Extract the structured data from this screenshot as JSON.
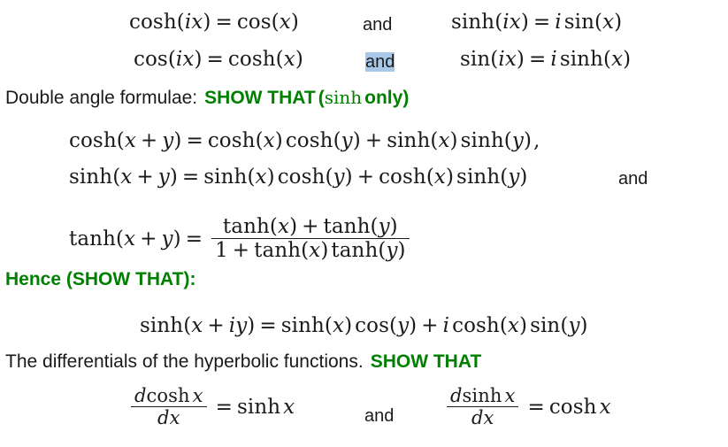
{
  "page": {
    "background_color": "#ffffff",
    "text_color": "#1a1a1a",
    "accent_color": "#008000",
    "highlight_color": "#a8c8e8"
  },
  "identities_rows": [
    {
      "left": "cosh(ix) = cos(x)",
      "connector": "and",
      "right": "sinh(ix) = i sin(x)"
    },
    {
      "left": "cos(ix) = cosh(x)",
      "connector": "and",
      "right": "sin(ix) = i sinh(x)"
    }
  ],
  "double_angle_heading": {
    "prefix": "Double angle formulae:",
    "show_that": "SHOW THAT",
    "paren_open": "(",
    "func": "sinh",
    "only": "only",
    "paren_close": ")"
  },
  "addition_formulae": [
    {
      "text": "cosh(x + y) = cosh(x) cosh(y) + sinh(x) sinh(y) ,",
      "trailing_comma": ","
    },
    {
      "text": "sinh(x + y) = sinh(x) cosh(y) + cosh(x) sinh(y)",
      "connector": "and"
    },
    {
      "lhs": "tanh(x + y) =",
      "numerator": "tanh(x) + tanh(y)",
      "denominator": "1 + tanh(x) tanh(y)"
    }
  ],
  "hence_heading": "Hence (SHOW THAT):",
  "complex_sinh": "sinh(x + iy) = sinh(x) cos(y) + i cosh(x) sin(y)",
  "differentials_heading": {
    "prefix": "The differentials of the hyperbolic functions.",
    "show_that": "SHOW THAT"
  },
  "derivatives": [
    {
      "numerator": "dcosh x",
      "denominator": "dx",
      "equals": "=",
      "result": "sinh x"
    },
    {
      "connector": "and"
    },
    {
      "numerator": "dsinh x",
      "denominator": "dx",
      "equals": "=",
      "result": "cosh x"
    }
  ],
  "symbols": {
    "equals": "=",
    "plus": "+",
    "comma": ",",
    "lparen": "(",
    "rparen": ")",
    "one": "1",
    "i": "i",
    "x": "x",
    "y": "y",
    "d": "d",
    "cosh": "cosh",
    "sinh": "sinh",
    "tanh": "tanh",
    "cos": "cos",
    "sin": "sin"
  }
}
